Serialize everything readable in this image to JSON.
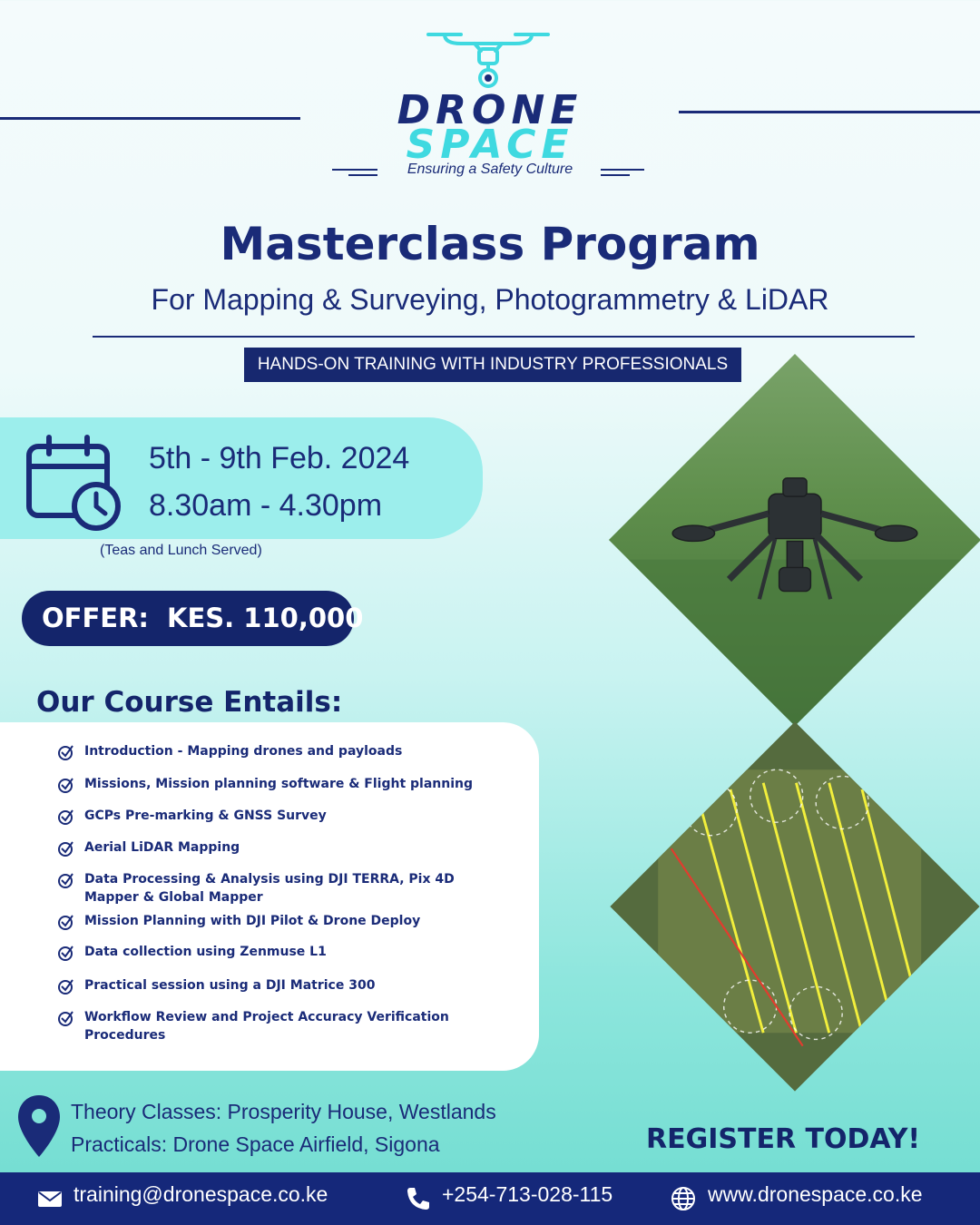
{
  "brand": {
    "name_line1": "DRONE",
    "name_line2": "SPACE",
    "tagline": "Ensuring a Safety Culture"
  },
  "header": {
    "title": "Masterclass Program",
    "subtitle": "For Mapping & Surveying, Photogrammetry & LiDAR",
    "badge": "HANDS-ON  TRAINING WITH INDUSTRY PROFESSIONALS"
  },
  "schedule": {
    "dates": "5th - 9th Feb. 2024",
    "time": "8.30am - 4.30pm",
    "note": "(Teas and Lunch Served)"
  },
  "offer": {
    "label": "OFFER:",
    "price": "KES. 110,000"
  },
  "course": {
    "title": "Our Course Entails:",
    "items": [
      "Introduction - Mapping drones and payloads",
      "Missions, Mission planning software & Flight planning",
      "GCPs Pre-marking & GNSS Survey",
      "Aerial LiDAR Mapping",
      "Data Processing & Analysis using DJI TERRA, Pix 4D Mapper & Global Mapper",
      "Mission Planning with DJI Pilot & Drone Deploy",
      "Data collection using Zenmuse L1",
      "Practical session using a DJI Matrice 300",
      "Workflow Review and Project Accuracy Verification Procedures"
    ]
  },
  "location": {
    "theory": "Theory Classes: Prosperity House, Westlands",
    "practicals": "Practicals: Drone Space Airfield, Sigona"
  },
  "cta": "REGISTER TODAY!",
  "contact": {
    "email": "training@dronespace.co.ke",
    "phone": "+254-713-028-115",
    "website": "www.dronespace.co.ke"
  },
  "colors": {
    "navy": "#1a2b78",
    "cyan": "#3fd9e0",
    "footer": "#15287a"
  },
  "icons": [
    "drone-logo-icon",
    "calendar-clock-icon",
    "check-circle-icon",
    "location-pin-icon",
    "mail-icon",
    "phone-icon",
    "globe-icon"
  ]
}
